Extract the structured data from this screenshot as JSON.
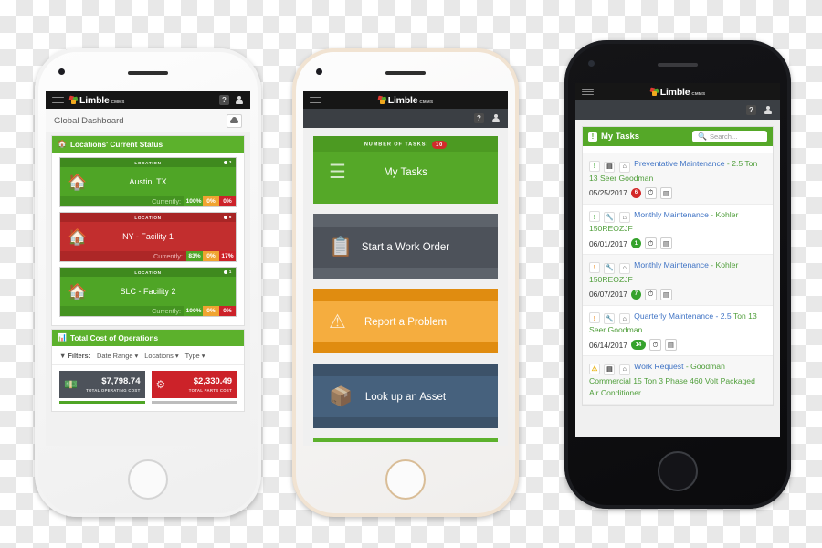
{
  "app": {
    "brand_name": "Limble",
    "brand_sub": "CMMS",
    "help_icon": "?",
    "user_icon": "user-icon",
    "menu_icon": "hamburger-icon"
  },
  "phone1": {
    "page_title": "Global Dashboard",
    "cloud_button_icon": "cloud-icon",
    "locations_panel": {
      "icon": "home-icon",
      "title": "Locations' Current Status",
      "card_label": "LOCATION",
      "currently_label": "Currently:",
      "cards": [
        {
          "name": "Austin, TX",
          "status": "green",
          "count": "3",
          "segments": [
            {
              "value": "100%",
              "color": "#4fa526"
            },
            {
              "value": "0%",
              "color": "#f0a431"
            },
            {
              "value": "0%",
              "color": "#cc2229"
            }
          ]
        },
        {
          "name": "NY - Facility 1",
          "status": "red",
          "count": "6",
          "segments": [
            {
              "value": "83%",
              "color": "#4fa526"
            },
            {
              "value": "0%",
              "color": "#f0a431"
            },
            {
              "value": "17%",
              "color": "#cc2229"
            }
          ]
        },
        {
          "name": "SLC - Facility 2",
          "status": "green",
          "count": "1",
          "segments": [
            {
              "value": "100%",
              "color": "#4fa526"
            },
            {
              "value": "0%",
              "color": "#f0a431"
            },
            {
              "value": "0%",
              "color": "#cc2229"
            }
          ]
        }
      ]
    },
    "cost_panel": {
      "icon": "bar-chart-icon",
      "title": "Total Cost of Operations",
      "filters_label": "Filters:",
      "filters": [
        "Date Range",
        "Locations",
        "Type"
      ],
      "cards": [
        {
          "icon": "money-icon",
          "amount": "$7,798.74",
          "caption": "TOTAL OPERATING COST",
          "color": "#4d525a"
        },
        {
          "icon": "gear-icon",
          "amount": "$2,330.49",
          "caption": "TOTAL PARTS COST",
          "color": "#cc2229"
        }
      ]
    }
  },
  "phone2": {
    "tiles": [
      {
        "caption": "NUMBER OF TASKS:",
        "badge": "10",
        "label": "My Tasks",
        "icon": "list-icon",
        "theme": "t-green"
      },
      {
        "caption": "",
        "badge": "",
        "label": "Start a Work Order",
        "icon": "clipboard-icon",
        "theme": "t-grey"
      },
      {
        "caption": "",
        "badge": "",
        "label": "Report a Problem",
        "icon": "warning-icon",
        "theme": "t-orange"
      },
      {
        "caption": "",
        "badge": "",
        "label": "Look up an Asset",
        "icon": "boxes-icon",
        "theme": "t-blue"
      }
    ]
  },
  "phone3": {
    "panel_title": "My Tasks",
    "panel_icon": "exclamation-icon",
    "search_placeholder": "Search...",
    "search_icon": "search-icon",
    "tasks": [
      {
        "priority_icon": "exclamation-green",
        "type_icon": "document-icon",
        "asset_icon": "home-icon",
        "title": "Preventative Maintenance",
        "dash": "-",
        "subject": "2.5 Ton 13 Seer Goodman",
        "date": "05/25/2017",
        "count": "6",
        "count_color": "red",
        "clock_icon": "clock-icon",
        "comment_icon": "comment-icon"
      },
      {
        "priority_icon": "exclamation-green",
        "type_icon": "wrench-icon",
        "asset_icon": "home-icon",
        "title": "Monthly Maintenance",
        "dash": "-",
        "subject": "Kohler 150REOZJF",
        "date": "06/01/2017",
        "count": "1",
        "count_color": "green",
        "clock_icon": "clock-icon",
        "comment_icon": "comment-icon"
      },
      {
        "priority_icon": "exclamation-orange",
        "type_icon": "wrench-icon",
        "asset_icon": "home-icon",
        "title": "Monthly Maintenance",
        "dash": "-",
        "subject": "Kohler 150REOZJF",
        "date": "06/07/2017",
        "count": "7",
        "count_color": "green",
        "clock_icon": "clock-icon",
        "comment_icon": "comment-icon"
      },
      {
        "priority_icon": "exclamation-orange",
        "type_icon": "wrench-icon",
        "asset_icon": "home-icon",
        "title": "Quarterly Maintenance - 2.5",
        "dash": "",
        "subject": "Ton 13 Seer Goodman",
        "date": "06/14/2017",
        "count": "14",
        "count_color": "green",
        "clock_icon": "clock-icon",
        "comment_icon": "comment-icon"
      },
      {
        "priority_icon": "warning-yellow",
        "type_icon": "document-icon",
        "asset_icon": "home-icon",
        "title": "Work Request",
        "dash": "-",
        "subject": "Goodman Commercial 15 Ton 3 Phase 460 Volt Packaged Air Conditioner",
        "date": "",
        "count": "",
        "count_color": "",
        "clock_icon": "",
        "comment_icon": ""
      }
    ]
  }
}
